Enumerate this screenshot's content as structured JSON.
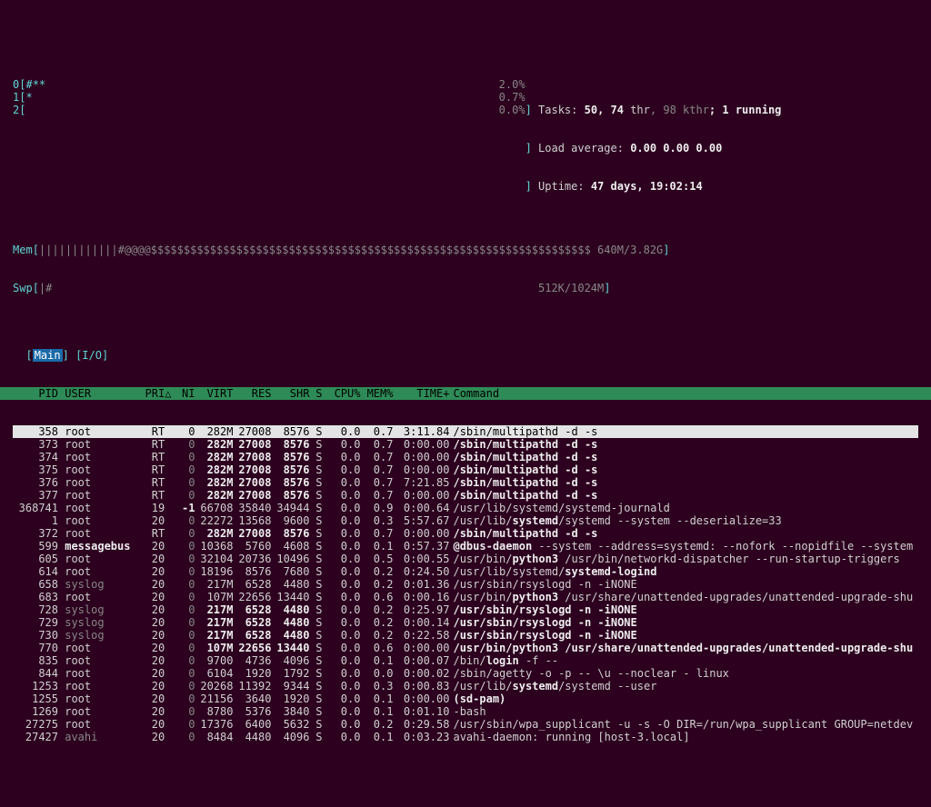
{
  "header": {
    "cpu_bars": [
      {
        "id": "0",
        "bar": "#**",
        "pct": "2.0%"
      },
      {
        "id": "1",
        "bar": "*",
        "pct": "0.7%"
      },
      {
        "id": "2",
        "bar": "",
        "pct": "0.0%"
      }
    ],
    "mem_label": "Mem",
    "mem_bar": "||||||||||||#@@@@$$$$$$$$$$$$$$$$$$$$$$$$$$$$$$$$$$$$$$$$$$$$$$$$$$$$$$$$$$$$$$$$$$$",
    "mem_text": "640M/3.82G",
    "swp_label": "Swp",
    "swp_bar": "|#",
    "swp_text": "512K/1024M",
    "tasks_label": "Tasks:",
    "tasks_total": "50",
    "tasks_sep": ", ",
    "tasks_thr": "74",
    "tasks_thr_label": " thr",
    "tasks_kthr": ", 98 kthr",
    "tasks_running": "; 1 running",
    "load_label": "Load average:",
    "load_values": "0.00 0.00 0.00",
    "uptime_label": "Uptime:",
    "uptime_value": "47 days, 19:02:14"
  },
  "tabs": {
    "main": "Main",
    "io": "I/O"
  },
  "columns": {
    "pid": "PID",
    "user": "USER",
    "pri": "PRI",
    "ni": "NI",
    "virt": "VIRT",
    "res": "RES",
    "shr": "SHR",
    "s": "S",
    "cpu": "CPU%",
    "mem": "MEM%",
    "time": "TIME+",
    "cmd": "Command"
  },
  "sort_arrow": "△",
  "selected_index": 0,
  "procs": [
    {
      "pid": "358",
      "user": "root",
      "pri": "RT",
      "ni": "0",
      "virt": "282M",
      "res": "27008",
      "shr": "8576",
      "s": "S",
      "cpu": "0.0",
      "mem": "0.7",
      "time": "3:11.84",
      "cmd": "/sbin/multipathd -d -s",
      "bold": false
    },
    {
      "pid": "373",
      "user": "root",
      "pri": "RT",
      "ni": "0",
      "virt": "282M",
      "res": "27008",
      "shr": "8576",
      "s": "S",
      "cpu": "0.0",
      "mem": "0.7",
      "time": "0:00.00",
      "cmd": "/sbin/multipathd -d -s",
      "bold": true
    },
    {
      "pid": "374",
      "user": "root",
      "pri": "RT",
      "ni": "0",
      "virt": "282M",
      "res": "27008",
      "shr": "8576",
      "s": "S",
      "cpu": "0.0",
      "mem": "0.7",
      "time": "0:00.00",
      "cmd": "/sbin/multipathd -d -s",
      "bold": true
    },
    {
      "pid": "375",
      "user": "root",
      "pri": "RT",
      "ni": "0",
      "virt": "282M",
      "res": "27008",
      "shr": "8576",
      "s": "S",
      "cpu": "0.0",
      "mem": "0.7",
      "time": "0:00.00",
      "cmd": "/sbin/multipathd -d -s",
      "bold": true
    },
    {
      "pid": "376",
      "user": "root",
      "pri": "RT",
      "ni": "0",
      "virt": "282M",
      "res": "27008",
      "shr": "8576",
      "s": "S",
      "cpu": "0.0",
      "mem": "0.7",
      "time": "7:21.85",
      "cmd": "/sbin/multipathd -d -s",
      "bold": true
    },
    {
      "pid": "377",
      "user": "root",
      "pri": "RT",
      "ni": "0",
      "virt": "282M",
      "res": "27008",
      "shr": "8576",
      "s": "S",
      "cpu": "0.0",
      "mem": "0.7",
      "time": "0:00.00",
      "cmd": "/sbin/multipathd -d -s",
      "bold": true
    },
    {
      "pid": "368741",
      "user": "root",
      "pri": "19",
      "ni": "-1",
      "virt": "66708",
      "res": "35840",
      "shr": "34944",
      "s": "S",
      "cpu": "0.0",
      "mem": "0.9",
      "time": "0:00.64",
      "cmd": "/usr/lib/systemd/systemd-journald",
      "bold": false
    },
    {
      "pid": "1",
      "user": "root",
      "pri": "20",
      "ni": "0",
      "virt": "22272",
      "res": "13568",
      "shr": "9600",
      "s": "S",
      "cpu": "0.0",
      "mem": "0.3",
      "time": "5:57.67",
      "cmd": "/usr/lib/systemd/systemd --system --deserialize=33",
      "bold": false,
      "bold_part": "systemd"
    },
    {
      "pid": "372",
      "user": "root",
      "pri": "RT",
      "ni": "0",
      "virt": "282M",
      "res": "27008",
      "shr": "8576",
      "s": "S",
      "cpu": "0.0",
      "mem": "0.7",
      "time": "0:00.00",
      "cmd": "/sbin/multipathd -d -s",
      "bold": true
    },
    {
      "pid": "599",
      "user": "messagebus",
      "pri": "20",
      "ni": "0",
      "virt": "10368",
      "res": "5760",
      "shr": "4608",
      "s": "S",
      "cpu": "0.0",
      "mem": "0.1",
      "time": "0:57.37",
      "cmd": "@dbus-daemon --system --address=systemd: --nofork --nopidfile --system",
      "bold": false,
      "bold_user": true,
      "bold_part": "@dbus-daemon"
    },
    {
      "pid": "605",
      "user": "root",
      "pri": "20",
      "ni": "0",
      "virt": "32104",
      "res": "20736",
      "shr": "10496",
      "s": "S",
      "cpu": "0.0",
      "mem": "0.5",
      "time": "0:00.55",
      "cmd": "/usr/bin/python3 /usr/bin/networkd-dispatcher --run-startup-triggers",
      "bold": false,
      "bold_part": "python3"
    },
    {
      "pid": "614",
      "user": "root",
      "pri": "20",
      "ni": "0",
      "virt": "18196",
      "res": "8576",
      "shr": "7680",
      "s": "S",
      "cpu": "0.0",
      "mem": "0.2",
      "time": "0:24.50",
      "cmd": "/usr/lib/systemd/systemd-logind",
      "bold": false,
      "bold_part": "systemd-logind"
    },
    {
      "pid": "658",
      "user": "syslog",
      "pri": "20",
      "ni": "0",
      "virt": "217M",
      "res": "6528",
      "shr": "4480",
      "s": "S",
      "cpu": "0.0",
      "mem": "0.2",
      "time": "0:01.36",
      "cmd": "/usr/sbin/rsyslogd -n -iNONE",
      "bold": false,
      "dim_user": true
    },
    {
      "pid": "683",
      "user": "root",
      "pri": "20",
      "ni": "0",
      "virt": "107M",
      "res": "22656",
      "shr": "13440",
      "s": "S",
      "cpu": "0.0",
      "mem": "0.6",
      "time": "0:00.16",
      "cmd": "/usr/bin/python3 /usr/share/unattended-upgrades/unattended-upgrade-shu",
      "bold": false,
      "bold_part": "python3"
    },
    {
      "pid": "728",
      "user": "syslog",
      "pri": "20",
      "ni": "0",
      "virt": "217M",
      "res": "6528",
      "shr": "4480",
      "s": "S",
      "cpu": "0.0",
      "mem": "0.2",
      "time": "0:25.97",
      "cmd": "/usr/sbin/rsyslogd -n -iNONE",
      "bold": true,
      "dim_user": true
    },
    {
      "pid": "729",
      "user": "syslog",
      "pri": "20",
      "ni": "0",
      "virt": "217M",
      "res": "6528",
      "shr": "4480",
      "s": "S",
      "cpu": "0.0",
      "mem": "0.2",
      "time": "0:00.14",
      "cmd": "/usr/sbin/rsyslogd -n -iNONE",
      "bold": true,
      "dim_user": true
    },
    {
      "pid": "730",
      "user": "syslog",
      "pri": "20",
      "ni": "0",
      "virt": "217M",
      "res": "6528",
      "shr": "4480",
      "s": "S",
      "cpu": "0.0",
      "mem": "0.2",
      "time": "0:22.58",
      "cmd": "/usr/sbin/rsyslogd -n -iNONE",
      "bold": true,
      "dim_user": true
    },
    {
      "pid": "770",
      "user": "root",
      "pri": "20",
      "ni": "0",
      "virt": "107M",
      "res": "22656",
      "shr": "13440",
      "s": "S",
      "cpu": "0.0",
      "mem": "0.6",
      "time": "0:00.00",
      "cmd": "/usr/bin/python3 /usr/share/unattended-upgrades/unattended-upgrade-shu",
      "bold": true
    },
    {
      "pid": "835",
      "user": "root",
      "pri": "20",
      "ni": "0",
      "virt": "9700",
      "res": "4736",
      "shr": "4096",
      "s": "S",
      "cpu": "0.0",
      "mem": "0.1",
      "time": "0:00.07",
      "cmd": "/bin/login -f --",
      "bold": false,
      "bold_part": "login"
    },
    {
      "pid": "844",
      "user": "root",
      "pri": "20",
      "ni": "0",
      "virt": "6104",
      "res": "1920",
      "shr": "1792",
      "s": "S",
      "cpu": "0.0",
      "mem": "0.0",
      "time": "0:00.02",
      "cmd": "/sbin/agetty -o -p -- \\u --noclear - linux",
      "bold": false
    },
    {
      "pid": "1253",
      "user": "root",
      "pri": "20",
      "ni": "0",
      "virt": "20268",
      "res": "11392",
      "shr": "9344",
      "s": "S",
      "cpu": "0.0",
      "mem": "0.3",
      "time": "0:00.83",
      "cmd": "/usr/lib/systemd/systemd --user",
      "bold": false,
      "bold_part": "systemd"
    },
    {
      "pid": "1255",
      "user": "root",
      "pri": "20",
      "ni": "0",
      "virt": "21156",
      "res": "3640",
      "shr": "1920",
      "s": "S",
      "cpu": "0.0",
      "mem": "0.1",
      "time": "0:00.00",
      "cmd": "(sd-pam)",
      "bold": false,
      "bold_part": "(sd-pam)"
    },
    {
      "pid": "1269",
      "user": "root",
      "pri": "20",
      "ni": "0",
      "virt": "8780",
      "res": "5376",
      "shr": "3840",
      "s": "S",
      "cpu": "0.0",
      "mem": "0.1",
      "time": "0:01.10",
      "cmd": "-bash",
      "bold": false
    },
    {
      "pid": "27275",
      "user": "root",
      "pri": "20",
      "ni": "0",
      "virt": "17376",
      "res": "6400",
      "shr": "5632",
      "s": "S",
      "cpu": "0.0",
      "mem": "0.2",
      "time": "0:29.58",
      "cmd": "/usr/sbin/wpa_supplicant -u -s -O DIR=/run/wpa_supplicant GROUP=netdev",
      "bold": false
    },
    {
      "pid": "27427",
      "user": "avahi",
      "pri": "20",
      "ni": "0",
      "virt": "8484",
      "res": "4480",
      "shr": "4096",
      "s": "S",
      "cpu": "0.0",
      "mem": "0.1",
      "time": "0:03.23",
      "cmd": "avahi-daemon: running [host-3.local]",
      "bold": false,
      "dim_user": true
    }
  ]
}
